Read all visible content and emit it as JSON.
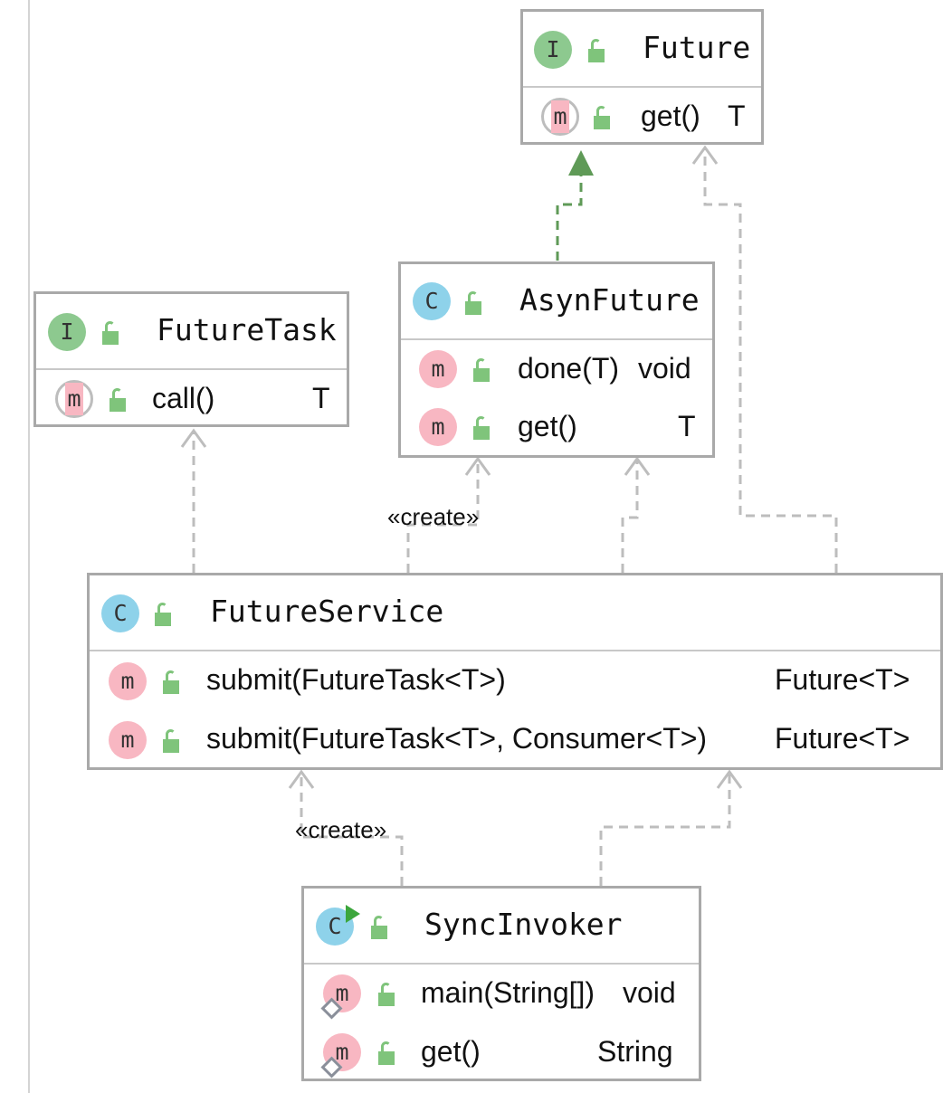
{
  "nodes": {
    "future": {
      "title": "Future",
      "kind": "interface",
      "methods": [
        {
          "name": "get()",
          "ret": "T",
          "kind": "abstract"
        }
      ]
    },
    "futuretask": {
      "title": "FutureTask",
      "kind": "interface",
      "methods": [
        {
          "name": "call()",
          "ret": "T",
          "kind": "abstract"
        }
      ]
    },
    "asynfuture": {
      "title": "AsynFuture",
      "kind": "class",
      "methods": [
        {
          "name": "done(T)",
          "ret": "void",
          "kind": "method"
        },
        {
          "name": "get()",
          "ret": "T",
          "kind": "method"
        }
      ]
    },
    "futureservice": {
      "title": "FutureService",
      "kind": "class",
      "methods": [
        {
          "name": "submit(FutureTask<T>)",
          "ret": "Future<T>",
          "kind": "method"
        },
        {
          "name": "submit(FutureTask<T>, Consumer<T>)",
          "ret": "Future<T>",
          "kind": "method"
        }
      ]
    },
    "syncinvoker": {
      "title": "SyncInvoker",
      "kind": "runnable-class",
      "methods": [
        {
          "name": "main(String[])",
          "ret": "void",
          "kind": "static-method"
        },
        {
          "name": "get()",
          "ret": "String",
          "kind": "static-method"
        }
      ]
    }
  },
  "badges": {
    "interface": "I",
    "class": "C",
    "method": "m"
  },
  "labels": {
    "create_upper": "«create»",
    "create_lower": "«create»"
  },
  "icons": {
    "visibility": "public-lock-icon",
    "interface": "interface-badge-icon",
    "class": "class-badge-icon",
    "method": "method-badge-icon",
    "run": "run-triangle-icon",
    "static": "static-diamond-icon"
  },
  "colors": {
    "border": "#a9a9a9",
    "dependency": "#bdbdbd",
    "realization": "#5f9a57",
    "interface_badge": "#8dc98f",
    "class_badge": "#8ed2ea",
    "method_badge": "#f8b7c2",
    "lock": "#7fc47b"
  }
}
